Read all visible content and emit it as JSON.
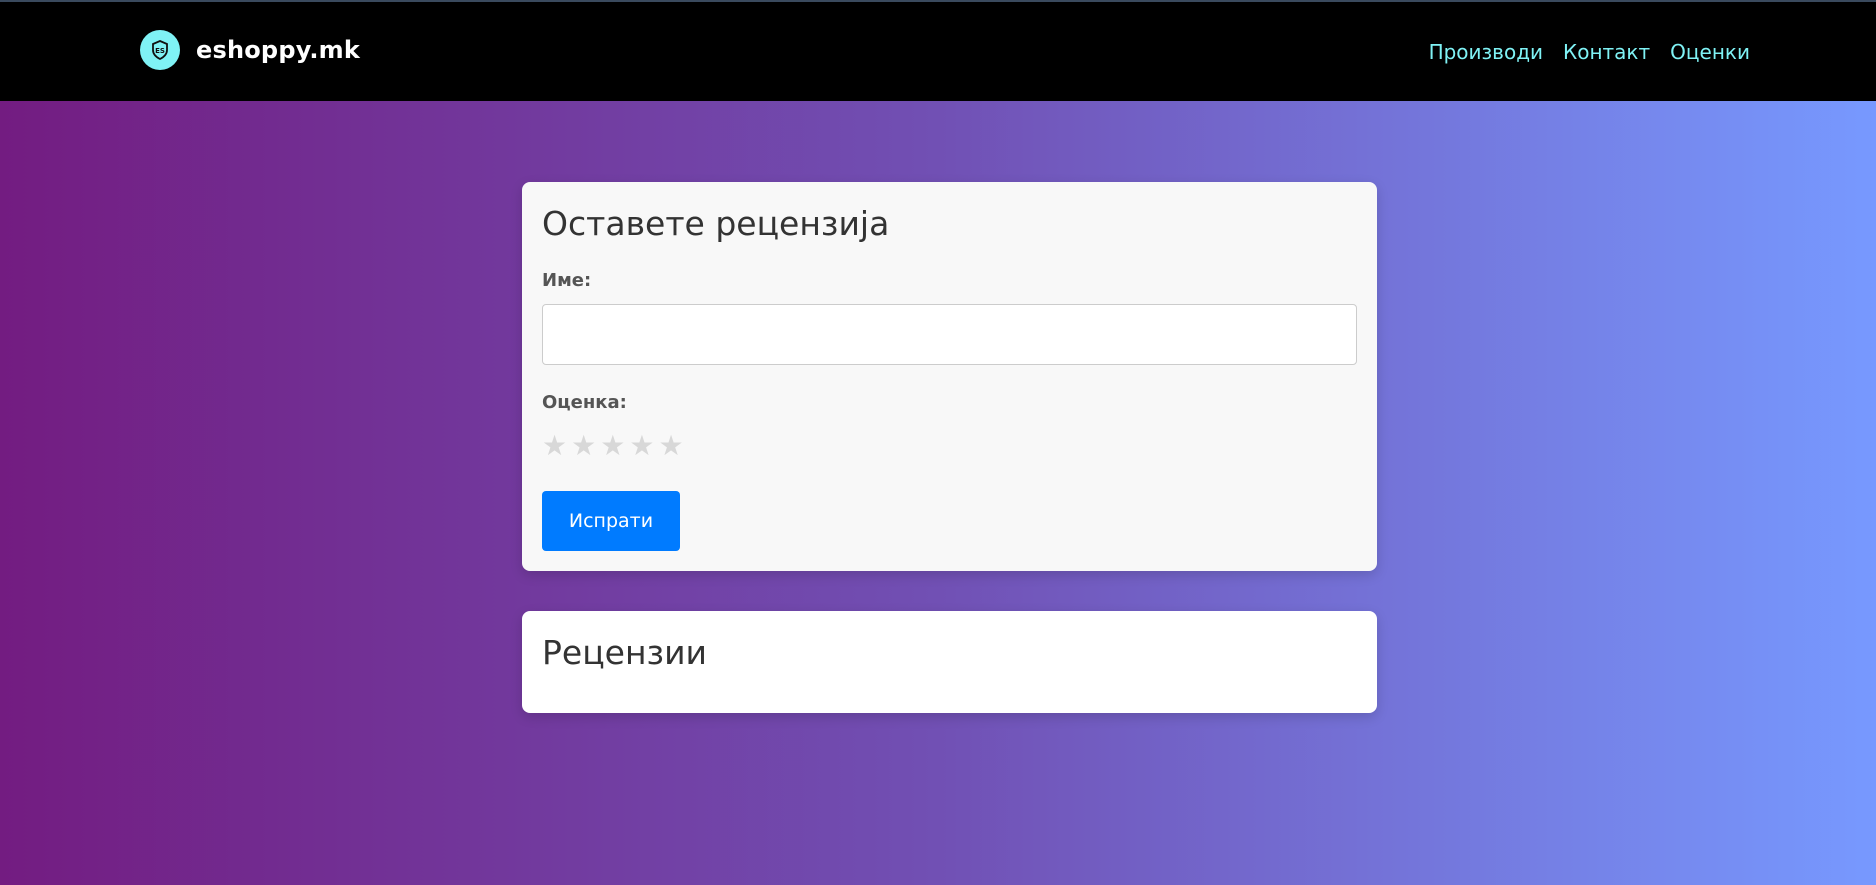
{
  "navbar": {
    "brand": "eshoppy.mk",
    "logo_icon": "shield-badge-icon",
    "links": [
      {
        "label": "Производи"
      },
      {
        "label": "Контакт"
      },
      {
        "label": "Оценки"
      }
    ]
  },
  "review_form": {
    "title": "Оставете рецензија",
    "name_label": "Име:",
    "name_value": "",
    "rating_label": "Оценка:",
    "rating_max": 5,
    "rating_value": 0,
    "star_icon": "star-icon",
    "submit_label": "Испрати"
  },
  "reviews": {
    "title": "Рецензии"
  },
  "colors": {
    "navbar_bg": "#000000",
    "nav_link": "#7ff2f5",
    "logo_bg": "#7ff2f5",
    "gradient_start": "#731c81",
    "gradient_end": "#7799ff",
    "button_bg": "#007bff",
    "star_inactive": "#d8d8d8"
  }
}
